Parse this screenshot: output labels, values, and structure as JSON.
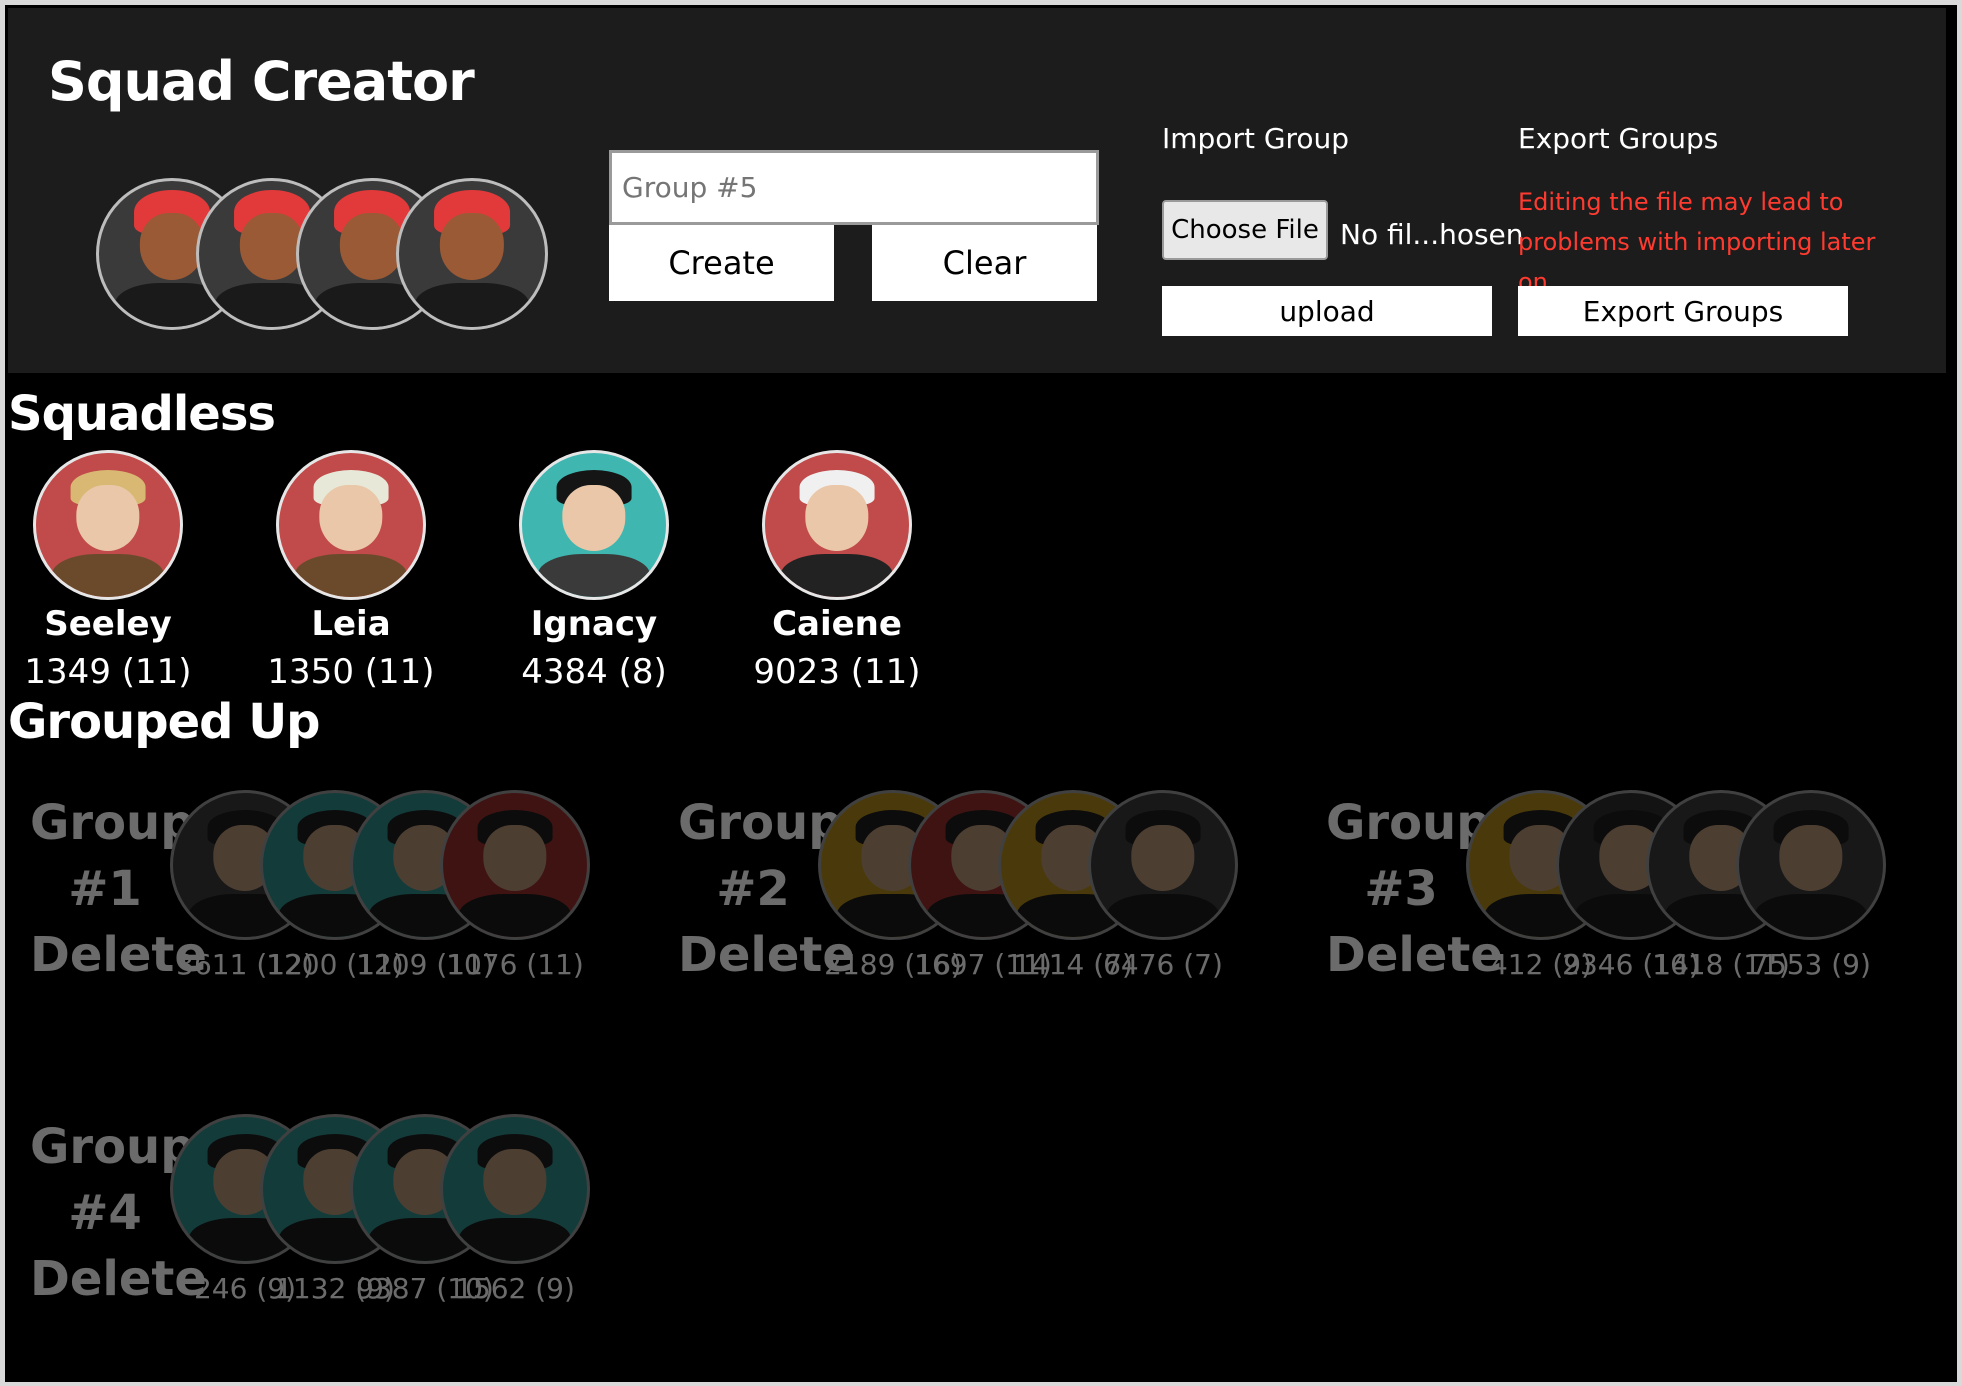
{
  "app": {
    "title": "Squad Creator"
  },
  "preview": {
    "count": 4
  },
  "creator": {
    "group_placeholder": "Group #5",
    "create_label": "Create",
    "clear_label": "Clear"
  },
  "import": {
    "title": "Import Group",
    "choose_label": "Choose File",
    "file_status": "No fil...hosen",
    "upload_label": "upload"
  },
  "export": {
    "title": "Export Groups",
    "warning": "Editing the file may lead to problems with importing later on",
    "button_label": "Export Groups"
  },
  "squadless": {
    "title": "Squadless",
    "members": [
      {
        "name": "Seeley",
        "stat": "1349 (11)",
        "bg": "#c14a4a",
        "hair": "#d8b873",
        "body": "#6b4a2c"
      },
      {
        "name": "Leia",
        "stat": "1350 (11)",
        "bg": "#c14a4a",
        "hair": "#e8e8d8",
        "body": "#6b4a2c"
      },
      {
        "name": "Ignacy",
        "stat": "4384 (8)",
        "bg": "#3fb6b0",
        "hair": "#151515",
        "body": "#3a3a3a"
      },
      {
        "name": "Caiene",
        "stat": "9023 (11)",
        "bg": "#c14a4a",
        "hair": "#f0f0f0",
        "body": "#222222"
      }
    ]
  },
  "grouped": {
    "title": "Grouped Up",
    "groups": [
      {
        "label": "Group #1",
        "delete": "Delete",
        "stats": [
          "3611 (12)",
          "1200 (11)",
          "1209 (11)",
          "1076 (11)"
        ],
        "colors": [
          "#3a3a3a",
          "#2f8e8a",
          "#2f8e8a",
          "#9a2e2e"
        ]
      },
      {
        "label": "Group #2",
        "delete": "Delete",
        "stats": [
          "2189 (16)",
          "1697 (11)",
          "1414 (7)",
          "6476 (7)"
        ],
        "colors": [
          "#b08a1c",
          "#9a2e2e",
          "#b08a1c",
          "#3a3a3a"
        ]
      },
      {
        "label": "Group #3",
        "delete": "Delete",
        "stats": [
          "412 (9)",
          "2346 (14)",
          "1618 (11)",
          "7553 (9)"
        ],
        "colors": [
          "#b08a1c",
          "#2e2e2e",
          "#3a3a3a",
          "#3a3a3a"
        ]
      },
      {
        "label": "Group #4",
        "delete": "Delete",
        "stats": [
          "246 (9)",
          "1132 (9)",
          "9387 (10)",
          "1562 (9)"
        ],
        "colors": [
          "#2f8e8a",
          "#2f8e8a",
          "#2f8e8a",
          "#2f8e8a"
        ]
      }
    ]
  }
}
